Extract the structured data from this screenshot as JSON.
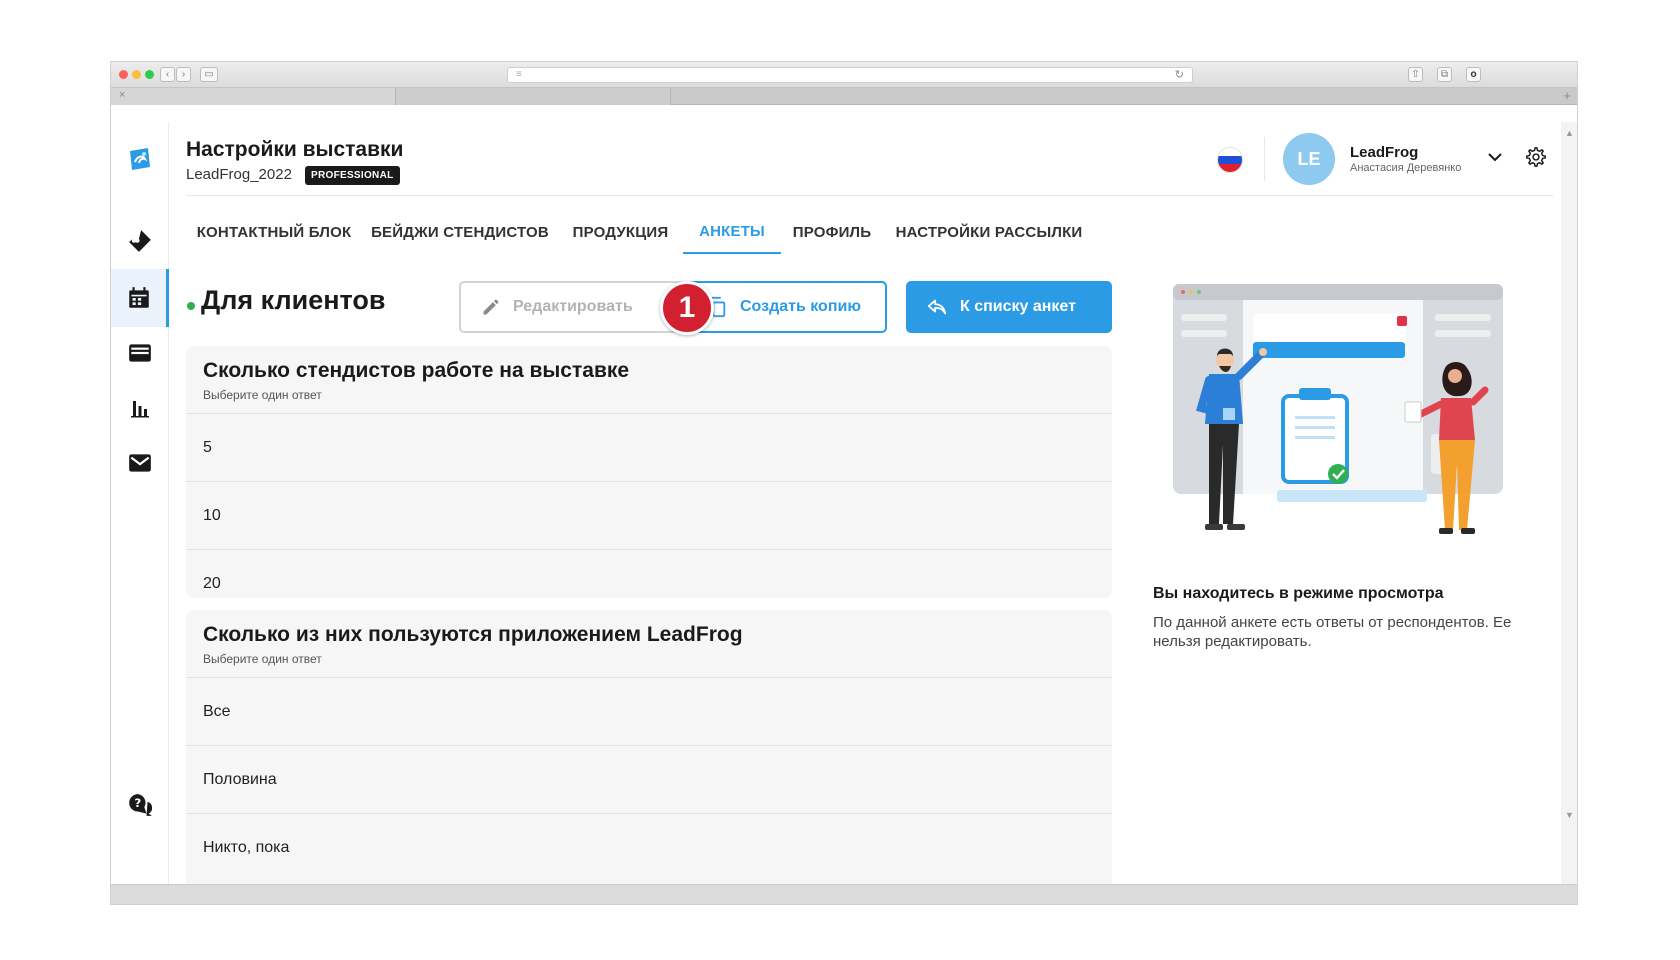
{
  "header": {
    "title": "Настройки выставки",
    "subtitle": "LeadFrog_2022",
    "badge": "PROFESSIONAL"
  },
  "user": {
    "initials": "LE",
    "name": "LeadFrog",
    "sub": "Анастасия Деревянко"
  },
  "tabs": [
    {
      "label": "КОНТАКТНЫЙ БЛОК",
      "active": false
    },
    {
      "label": "БЕЙДЖИ СТЕНДИСТОВ",
      "active": false
    },
    {
      "label": "ПРОДУКЦИЯ",
      "active": false
    },
    {
      "label": "АНКЕТЫ",
      "active": true
    },
    {
      "label": "ПРОФИЛЬ",
      "active": false
    },
    {
      "label": "НАСТРОЙКИ РАССЫЛКИ",
      "active": false
    }
  ],
  "section": {
    "title": "Для клиентов",
    "edit_label": "Редактировать",
    "copy_label": "Создать копию",
    "list_label": "К списку анкет",
    "marker": "1"
  },
  "questions": [
    {
      "title": "Сколько стендистов работе на выставке",
      "hint": "Выберите один ответ",
      "options": [
        "5",
        "10",
        "20"
      ]
    },
    {
      "title": "Сколько из них пользуются приложением LeadFrog",
      "hint": "Выберите один ответ",
      "options": [
        "Все",
        "Половина",
        "Никто, пока"
      ]
    }
  ],
  "info": {
    "title": "Вы находитесь в режиме просмотра",
    "text": "По данной анкете есть ответы от респондентов. Ее нельзя редактировать."
  },
  "colors": {
    "accent": "#2b9be6",
    "marker": "#d32030",
    "status_dot": "#2fae52"
  },
  "icons": [
    "logo-icon",
    "ticket-icon",
    "calendar-icon",
    "inbox-icon",
    "chart-icon",
    "mail-icon",
    "help-icon",
    "pencil-icon",
    "copy-icon",
    "reply-icon",
    "chevron-down-icon",
    "gear-icon"
  ]
}
